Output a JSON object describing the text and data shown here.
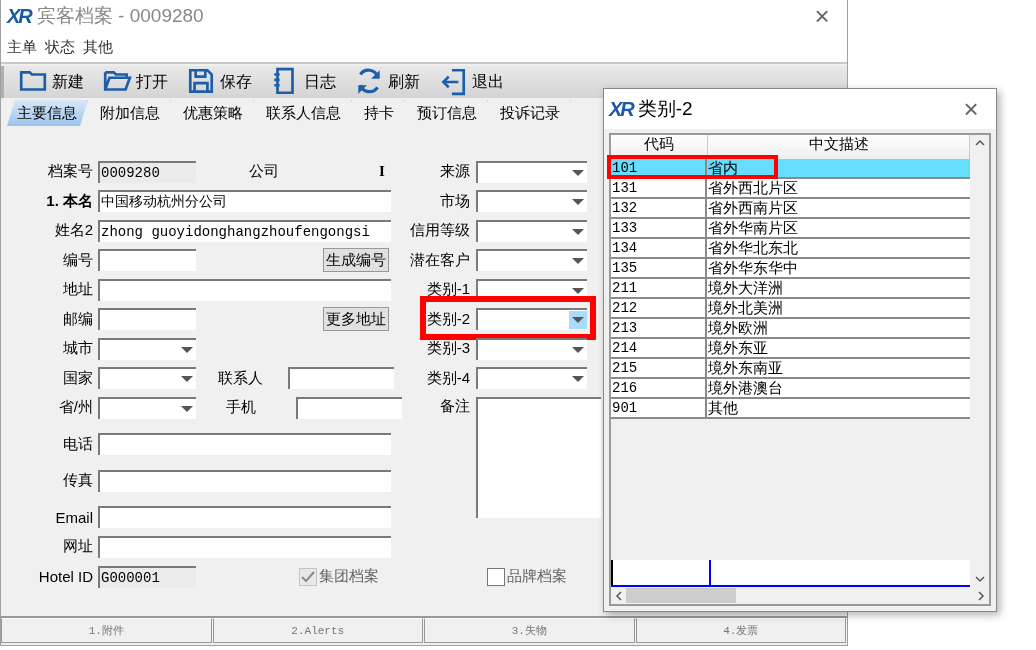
{
  "window": {
    "logo": "XR",
    "title": "宾客档案 - 0009280",
    "close": "×"
  },
  "menu": [
    "主单",
    "状态",
    "其他"
  ],
  "toolbar": [
    {
      "label": "新建",
      "kind": "new"
    },
    {
      "label": "打开",
      "kind": "open"
    },
    {
      "label": "保存",
      "kind": "save"
    },
    {
      "label": "日志",
      "kind": "log"
    },
    {
      "label": "刷新",
      "kind": "refresh"
    },
    {
      "label": "退出",
      "kind": "exit"
    }
  ],
  "tabs": [
    {
      "label": "主要信息",
      "selected": true
    },
    {
      "label": "附加信息",
      "selected": false
    },
    {
      "label": "优惠策略",
      "selected": false
    },
    {
      "label": "联系人信息",
      "selected": false
    },
    {
      "label": "持卡",
      "selected": false
    },
    {
      "label": "预订信息",
      "selected": false
    },
    {
      "label": "投诉记录",
      "selected": false
    }
  ],
  "form": {
    "file_no": {
      "label": "档案号",
      "value": "0009280"
    },
    "type": {
      "label": "公司",
      "value": "I"
    },
    "name": {
      "label": "1. 本名",
      "value": "中国移动杭州分公司"
    },
    "name2": {
      "label": "姓名2",
      "value": "zhong guoyidonghangzhoufengongsi"
    },
    "number": {
      "label": "编号",
      "button": "生成编号"
    },
    "address": {
      "label": "地址"
    },
    "zip": {
      "label": "邮编",
      "button": "更多地址"
    },
    "city": {
      "label": "城市"
    },
    "country": {
      "label": "国家",
      "contact_label": "联系人"
    },
    "state": {
      "label": "省/州",
      "mobile_label": "手机"
    },
    "phone": {
      "label": "电话"
    },
    "fax": {
      "label": "传真"
    },
    "email": {
      "label": "Email"
    },
    "website": {
      "label": "网址"
    },
    "hotel_id": {
      "label": "Hotel ID",
      "value": "G000001"
    },
    "checkboxes": [
      {
        "label": "集团档案",
        "checked": true,
        "disabled": true
      },
      {
        "label": "品牌档案",
        "checked": false,
        "disabled": false
      }
    ],
    "combos": [
      {
        "label": "来源",
        "focused": false,
        "highlighted": false
      },
      {
        "label": "市场",
        "focused": false,
        "highlighted": false
      },
      {
        "label": "信用等级",
        "focused": false,
        "highlighted": false
      },
      {
        "label": "潜在客户",
        "focused": false,
        "highlighted": false
      },
      {
        "label": "类别-1",
        "focused": false,
        "highlighted": false
      },
      {
        "label": "类别-2",
        "focused": true,
        "highlighted": true
      },
      {
        "label": "类别-3",
        "focused": false,
        "highlighted": false
      },
      {
        "label": "类别-4",
        "focused": false,
        "highlighted": false
      }
    ],
    "remark": {
      "label": "备注"
    }
  },
  "bottom_tabs": [
    "1.附件",
    "2.Alerts",
    "3.失物",
    "4.发票"
  ],
  "popup": {
    "logo": "XR",
    "title": "类别-2",
    "close": "×",
    "columns": [
      "代码",
      "中文描述"
    ],
    "rows": [
      {
        "code": "101",
        "desc": "省内",
        "selected": true,
        "highlighted": true
      },
      {
        "code": "131",
        "desc": "省外西北片区",
        "selected": false,
        "highlighted": false
      },
      {
        "code": "132",
        "desc": "省外西南片区",
        "selected": false,
        "highlighted": false
      },
      {
        "code": "133",
        "desc": "省外华南片区",
        "selected": false,
        "highlighted": false
      },
      {
        "code": "134",
        "desc": "省外华北东北",
        "selected": false,
        "highlighted": false
      },
      {
        "code": "135",
        "desc": "省外华东华中",
        "selected": false,
        "highlighted": false
      },
      {
        "code": "211",
        "desc": "境外大洋洲",
        "selected": false,
        "highlighted": false
      },
      {
        "code": "212",
        "desc": "境外北美洲",
        "selected": false,
        "highlighted": false
      },
      {
        "code": "213",
        "desc": "境外欧洲",
        "selected": false,
        "highlighted": false
      },
      {
        "code": "214",
        "desc": "境外东亚",
        "selected": false,
        "highlighted": false
      },
      {
        "code": "215",
        "desc": "境外东南亚",
        "selected": false,
        "highlighted": false
      },
      {
        "code": "216",
        "desc": "境外港澳台",
        "selected": false,
        "highlighted": false
      },
      {
        "code": "901",
        "desc": "其他",
        "selected": false,
        "highlighted": false
      }
    ]
  }
}
